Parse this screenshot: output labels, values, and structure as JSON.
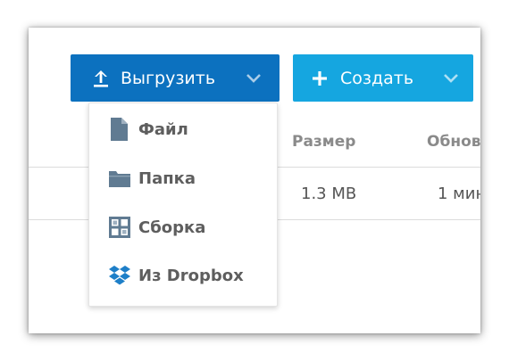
{
  "toolbar": {
    "upload_label": "Выгрузить",
    "create_label": "Создать"
  },
  "upload_menu": {
    "items": [
      {
        "label": "Файл",
        "icon": "file-icon"
      },
      {
        "label": "Папка",
        "icon": "folder-icon"
      },
      {
        "label": "Сборка",
        "icon": "collection-icon"
      },
      {
        "label": "Из Dropbox",
        "icon": "dropbox-icon"
      }
    ]
  },
  "table": {
    "columns": [
      "Размер",
      "Обнов"
    ],
    "rows": [
      {
        "size": "1.3 MB",
        "updated": "1 мин"
      }
    ]
  },
  "colors": {
    "upload_button": "#0c71bf",
    "create_button": "#15a6e0",
    "menu_icon": "#607b92",
    "dropbox_icon": "#1e7fc8"
  }
}
